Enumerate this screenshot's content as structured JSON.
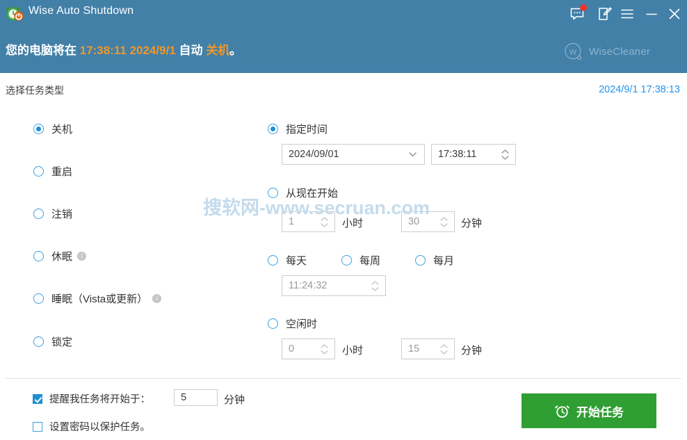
{
  "window": {
    "title": "Wise Auto Shutdown",
    "app_icon": "alarm-clock-icon",
    "titlebar_buttons": [
      {
        "name": "feedback-icon",
        "label": "feedback"
      },
      {
        "name": "edit-icon",
        "label": "edit"
      },
      {
        "name": "menu-icon",
        "label": "menu"
      },
      {
        "name": "minimize-icon",
        "label": "minimize"
      },
      {
        "name": "close-icon",
        "label": "close"
      }
    ]
  },
  "header": {
    "banner_prefix": "您的电脑将在 ",
    "banner_time": "17:38:11 2024/9/1",
    "banner_middle": " 自动 ",
    "banner_action": "关机",
    "banner_suffix": "。",
    "brand_text": "WiseCleaner",
    "brand_mark": "W",
    "background_color": "#4280a8",
    "highlight_color": "#f0972b"
  },
  "subheader": {
    "task_type_label": "选择任务类型",
    "clock": "2024/9/1 17:38:13",
    "clock_color": "#2196f3"
  },
  "task_types": [
    {
      "label": "关机",
      "selected": true,
      "info": false
    },
    {
      "label": "重启",
      "selected": false,
      "info": false
    },
    {
      "label": "注销",
      "selected": false,
      "info": false
    },
    {
      "label": "休眠",
      "selected": false,
      "info": true
    },
    {
      "label": "睡眠（Vista或更新）",
      "selected": false,
      "info": true
    },
    {
      "label": "锁定",
      "selected": false,
      "info": false
    }
  ],
  "schedule": {
    "specific_time": {
      "label": "指定时间",
      "selected": true,
      "date_value": "2024/09/01",
      "time_value": "17:38:11"
    },
    "from_now": {
      "label": "从现在开始",
      "selected": false,
      "hours_value": "1",
      "hours_unit": "小时",
      "minutes_value": "30",
      "minutes_unit": "分钟"
    },
    "recurring": {
      "daily_label": "每天",
      "weekly_label": "每周",
      "monthly_label": "每月",
      "daily_selected": false,
      "weekly_selected": false,
      "monthly_selected": false,
      "time_value": "11:24:32"
    },
    "on_idle": {
      "label": "空闲时",
      "selected": false,
      "hours_value": "0",
      "hours_unit": "小时",
      "minutes_value": "15",
      "minutes_unit": "分钟"
    }
  },
  "footer": {
    "remind_label": "提醒我任务将开始于：",
    "remind_checked": true,
    "remind_value": "5",
    "remind_unit": "分钟",
    "password_label": "设置密码以保护任务。",
    "password_checked": false,
    "start_button_label": "开始任务",
    "start_button_icon": "alarm-clock-icon",
    "start_button_color": "#2f9e33"
  },
  "watermark": {
    "text": "搜软网-www.secruan.com",
    "color": "#c4dbec"
  }
}
